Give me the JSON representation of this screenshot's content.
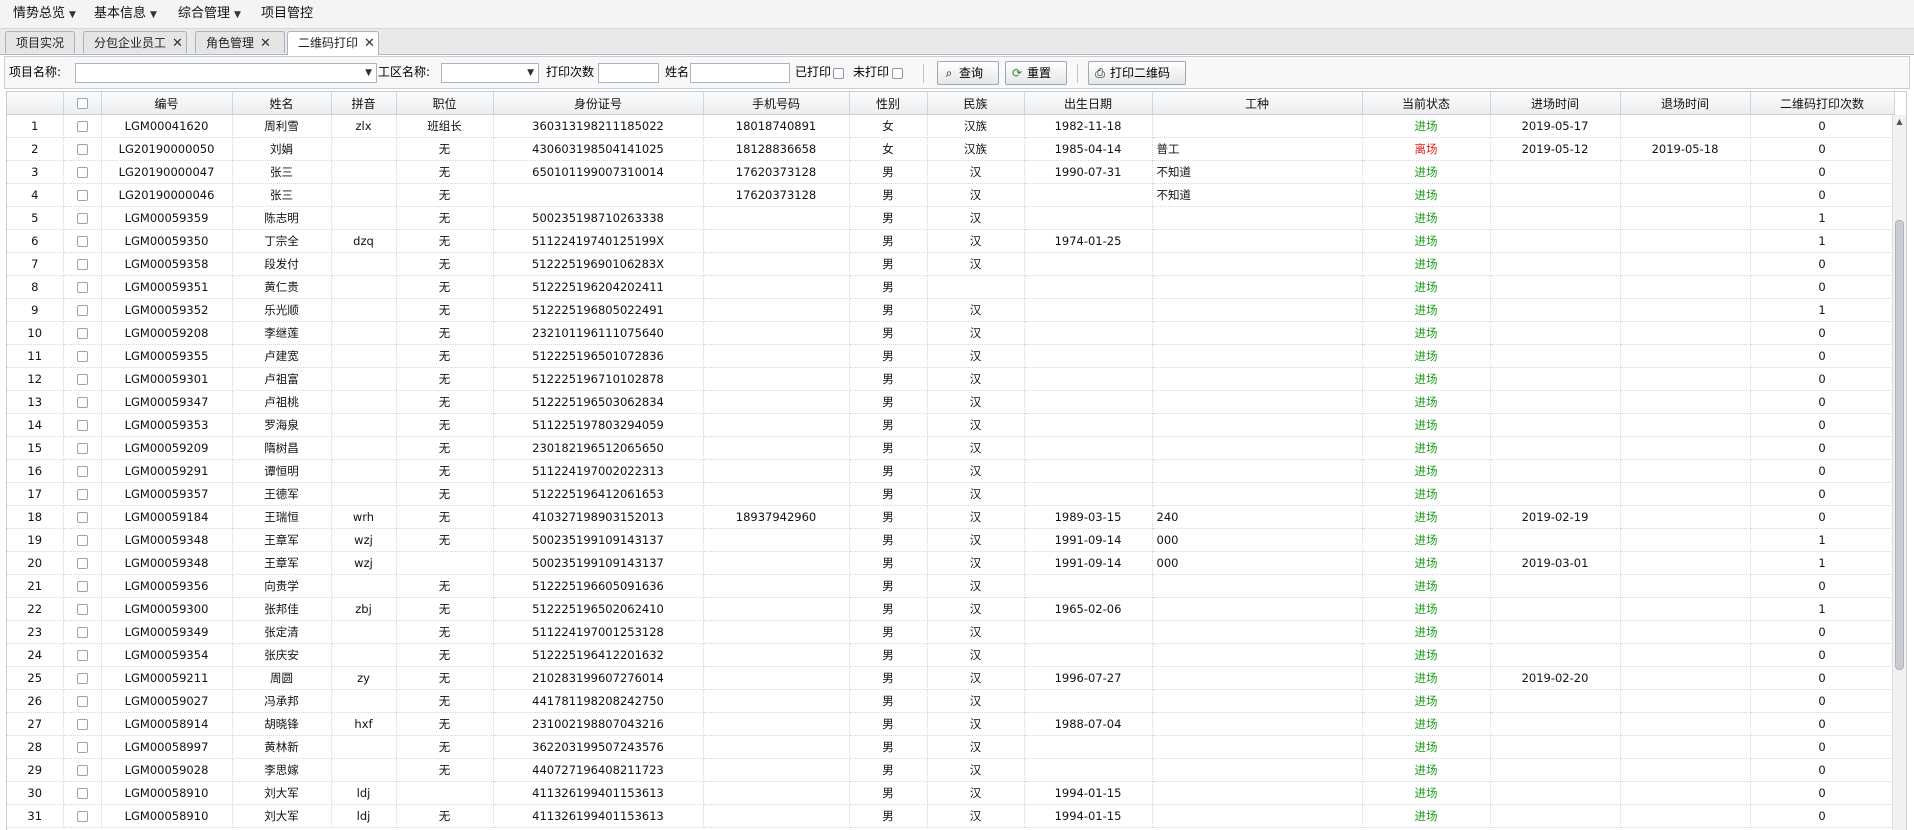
{
  "menubar": {
    "items": [
      {
        "label": "情势总览",
        "has_caret": true
      },
      {
        "label": "基本信息",
        "has_caret": true
      },
      {
        "label": "综合管理",
        "has_caret": true
      },
      {
        "label": "项目管控",
        "has_caret": false
      }
    ]
  },
  "tabs": [
    {
      "label": "项目实况",
      "closable": false,
      "active": false
    },
    {
      "label": "分包企业员工",
      "closable": true,
      "active": false
    },
    {
      "label": "角色管理",
      "closable": true,
      "active": false
    },
    {
      "label": "二维码打印",
      "closable": true,
      "active": true
    }
  ],
  "toolbar": {
    "project_name_label": "项目名称:",
    "project_name_value": "",
    "work_area_label": "工区名称:",
    "work_area_value": "",
    "print_count_label": "打印次数",
    "print_count_value": "",
    "name_label": "姓名",
    "name_value": "",
    "printed_label": "已打印",
    "printed_checked": false,
    "unprinted_label": "未打印",
    "unprinted_checked": false,
    "query_button": "查询",
    "reset_button": "重置",
    "print_qr_button": "打印二维码"
  },
  "table": {
    "columns": [
      "",
      "",
      "编号",
      "姓名",
      "拼音",
      "职位",
      "身份证号",
      "手机号码",
      "性别",
      "民族",
      "出生日期",
      "工种",
      "当前状态",
      "进场时间",
      "退场时间",
      "二维码打印次数"
    ],
    "rows": [
      [
        "1",
        "LGM00041620",
        "周利雪",
        "zlx",
        "班组长",
        "360313198211185022",
        "18018740891",
        "女",
        "汉族",
        "1982-11-18",
        "",
        "进场",
        "2019-05-17",
        "",
        "0"
      ],
      [
        "2",
        "LG20190000050",
        "刘娟",
        "",
        "无",
        "430603198504141025",
        "18128836658",
        "女",
        "汉族",
        "1985-04-14",
        "普工",
        "离场",
        "2019-05-12",
        "2019-05-18",
        "0"
      ],
      [
        "3",
        "LG20190000047",
        "张三",
        "",
        "无",
        "650101199007310014",
        "17620373128",
        "男",
        "汉",
        "1990-07-31",
        "不知道",
        "进场",
        "",
        "",
        "0"
      ],
      [
        "4",
        "LG20190000046",
        "张三",
        "",
        "无",
        "",
        "17620373128",
        "男",
        "汉",
        "",
        "不知道",
        "进场",
        "",
        "",
        "0"
      ],
      [
        "5",
        "LGM00059359",
        "陈志明",
        "",
        "无",
        "500235198710263338",
        "",
        "男",
        "汉",
        "",
        "",
        "进场",
        "",
        "",
        "1"
      ],
      [
        "6",
        "LGM00059350",
        "丁宗全",
        "dzq",
        "无",
        "51122419740125199X",
        "",
        "男",
        "汉",
        "1974-01-25",
        "",
        "进场",
        "",
        "",
        "1"
      ],
      [
        "7",
        "LGM00059358",
        "段发付",
        "",
        "无",
        "51222519690106283X",
        "",
        "男",
        "汉",
        "",
        "",
        "进场",
        "",
        "",
        "0"
      ],
      [
        "8",
        "LGM00059351",
        "黄仁贵",
        "",
        "无",
        "512225196204202411",
        "",
        "男",
        "",
        "",
        "",
        "进场",
        "",
        "",
        "0"
      ],
      [
        "9",
        "LGM00059352",
        "乐光顺",
        "",
        "无",
        "512225196805022491",
        "",
        "男",
        "汉",
        "",
        "",
        "进场",
        "",
        "",
        "1"
      ],
      [
        "10",
        "LGM00059208",
        "李继莲",
        "",
        "无",
        "232101196111075640",
        "",
        "男",
        "汉",
        "",
        "",
        "进场",
        "",
        "",
        "0"
      ],
      [
        "11",
        "LGM00059355",
        "卢建宽",
        "",
        "无",
        "512225196501072836",
        "",
        "男",
        "汉",
        "",
        "",
        "进场",
        "",
        "",
        "0"
      ],
      [
        "12",
        "LGM00059301",
        "卢祖富",
        "",
        "无",
        "512225196710102878",
        "",
        "男",
        "汉",
        "",
        "",
        "进场",
        "",
        "",
        "0"
      ],
      [
        "13",
        "LGM00059347",
        "卢祖桃",
        "",
        "无",
        "512225196503062834",
        "",
        "男",
        "汉",
        "",
        "",
        "进场",
        "",
        "",
        "0"
      ],
      [
        "14",
        "LGM00059353",
        "罗海泉",
        "",
        "无",
        "511225197803294059",
        "",
        "男",
        "汉",
        "",
        "",
        "进场",
        "",
        "",
        "0"
      ],
      [
        "15",
        "LGM00059209",
        "隋树昌",
        "",
        "无",
        "230182196512065650",
        "",
        "男",
        "汉",
        "",
        "",
        "进场",
        "",
        "",
        "0"
      ],
      [
        "16",
        "LGM00059291",
        "谭恒明",
        "",
        "无",
        "511224197002022313",
        "",
        "男",
        "汉",
        "",
        "",
        "进场",
        "",
        "",
        "0"
      ],
      [
        "17",
        "LGM00059357",
        "王德军",
        "",
        "无",
        "512225196412061653",
        "",
        "男",
        "汉",
        "",
        "",
        "进场",
        "",
        "",
        "0"
      ],
      [
        "18",
        "LGM00059184",
        "王瑞恒",
        "wrh",
        "无",
        "410327198903152013",
        "18937942960",
        "男",
        "汉",
        "1989-03-15",
        "240",
        "进场",
        "2019-02-19",
        "",
        "0"
      ],
      [
        "19",
        "LGM00059348",
        "王章军",
        "wzj",
        "无",
        "500235199109143137",
        "",
        "男",
        "汉",
        "1991-09-14",
        "000",
        "进场",
        "",
        "",
        "1"
      ],
      [
        "20",
        "LGM00059348",
        "王章军",
        "wzj",
        "",
        "500235199109143137",
        "",
        "男",
        "汉",
        "1991-09-14",
        "000",
        "进场",
        "2019-03-01",
        "",
        "1"
      ],
      [
        "21",
        "LGM00059356",
        "向贵学",
        "",
        "无",
        "512225196605091636",
        "",
        "男",
        "汉",
        "",
        "",
        "进场",
        "",
        "",
        "0"
      ],
      [
        "22",
        "LGM00059300",
        "张邦佳",
        "zbj",
        "无",
        "512225196502062410",
        "",
        "男",
        "汉",
        "1965-02-06",
        "",
        "进场",
        "",
        "",
        "1"
      ],
      [
        "23",
        "LGM00059349",
        "张定清",
        "",
        "无",
        "511224197001253128",
        "",
        "男",
        "汉",
        "",
        "",
        "进场",
        "",
        "",
        "0"
      ],
      [
        "24",
        "LGM00059354",
        "张庆安",
        "",
        "无",
        "512225196412201632",
        "",
        "男",
        "汉",
        "",
        "",
        "进场",
        "",
        "",
        "0"
      ],
      [
        "25",
        "LGM00059211",
        "周圆",
        "zy",
        "无",
        "210283199607276014",
        "",
        "男",
        "汉",
        "1996-07-27",
        "",
        "进场",
        "2019-02-20",
        "",
        "0"
      ],
      [
        "26",
        "LGM00059027",
        "冯承邦",
        "",
        "无",
        "441781198208242750",
        "",
        "男",
        "汉",
        "",
        "",
        "进场",
        "",
        "",
        "0"
      ],
      [
        "27",
        "LGM00058914",
        "胡晓锋",
        "hxf",
        "无",
        "231002198807043216",
        "",
        "男",
        "汉",
        "1988-07-04",
        "",
        "进场",
        "",
        "",
        "0"
      ],
      [
        "28",
        "LGM00058997",
        "黄林新",
        "",
        "无",
        "362203199507243576",
        "",
        "男",
        "汉",
        "",
        "",
        "进场",
        "",
        "",
        "0"
      ],
      [
        "29",
        "LGM00059028",
        "李思嫁",
        "",
        "无",
        "440727196408211723",
        "",
        "男",
        "汉",
        "",
        "",
        "进场",
        "",
        "",
        "0"
      ],
      [
        "30",
        "LGM00058910",
        "刘大军",
        "ldj",
        "",
        "411326199401153613",
        "",
        "男",
        "汉",
        "1994-01-15",
        "",
        "进场",
        "",
        "",
        "0"
      ],
      [
        "31",
        "LGM00058910",
        "刘大军",
        "ldj",
        "无",
        "411326199401153613",
        "",
        "男",
        "汉",
        "1994-01-15",
        "",
        "进场",
        "",
        "",
        "0"
      ]
    ]
  },
  "colors": {
    "status_in": "#1a9a1a",
    "status_out": "#e02020"
  },
  "icons": {
    "query_button": "search-icon",
    "reset_button": "refresh-icon",
    "print_qr_button": "printer-icon"
  }
}
